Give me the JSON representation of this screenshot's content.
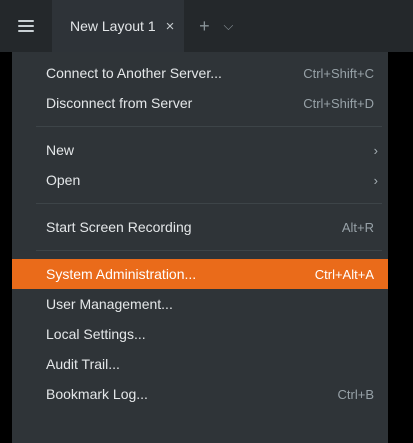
{
  "topbar": {
    "tab_title": "New Layout 1",
    "tab_close_glyph": "×",
    "add_tab_glyph": "+",
    "tab_list_glyph": "⌵",
    "menu_icon": "hamburger-icon"
  },
  "menu": {
    "groups": [
      [
        {
          "label": "Connect to Another Server...",
          "shortcut": "Ctrl+Shift+C"
        },
        {
          "label": "Disconnect from Server",
          "shortcut": "Ctrl+Shift+D"
        }
      ],
      [
        {
          "label": "New",
          "submenu": true
        },
        {
          "label": "Open",
          "submenu": true
        }
      ],
      [
        {
          "label": "Start Screen Recording",
          "shortcut": "Alt+R"
        }
      ],
      [
        {
          "label": "System Administration...",
          "shortcut": "Ctrl+Alt+A",
          "highlighted": true
        },
        {
          "label": "User Management...",
          "shortcut": ""
        },
        {
          "label": "Local Settings...",
          "shortcut": ""
        },
        {
          "label": "Audit Trail...",
          "shortcut": ""
        },
        {
          "label": "Bookmark Log...",
          "shortcut": "Ctrl+B"
        }
      ]
    ],
    "submenu_arrow": "›",
    "highlight_color": "#ea6b1a"
  }
}
